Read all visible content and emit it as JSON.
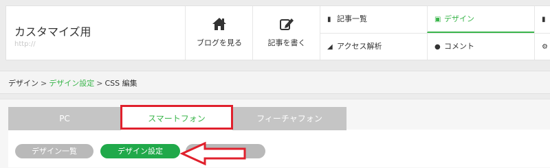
{
  "site": {
    "name": "カスタマイズ用",
    "url": "http://"
  },
  "header_buttons": [
    {
      "label": "ブログを見る",
      "icon": "home-icon"
    },
    {
      "label": "記事を書く",
      "icon": "edit-icon"
    }
  ],
  "menu": {
    "articles": {
      "label": "記事一覧",
      "icon": "book-icon"
    },
    "access": {
      "label": "アクセス解析",
      "icon": "chart-icon"
    },
    "design": {
      "label": "デザイン",
      "icon": "image-icon"
    },
    "comment": {
      "label": "コメント",
      "icon": "comment-icon"
    }
  },
  "breadcrumb": {
    "root": "デザイン",
    "sep1": ">",
    "middle": "デザイン設定",
    "sep2": ">",
    "current": "CSS 編集"
  },
  "tabs": [
    {
      "label": "PC",
      "active": false
    },
    {
      "label": "スマートフォン",
      "active": true
    },
    {
      "label": "フィーチャフォン",
      "active": false
    }
  ],
  "subtabs": [
    {
      "label": "デザイン一覧",
      "active": false
    },
    {
      "label": "デザイン設定",
      "active": true
    },
    {
      "label": "",
      "active": false
    }
  ],
  "colors": {
    "accent": "#39b54a",
    "pill_active": "#20a94a",
    "annotation": "#e0202c"
  }
}
